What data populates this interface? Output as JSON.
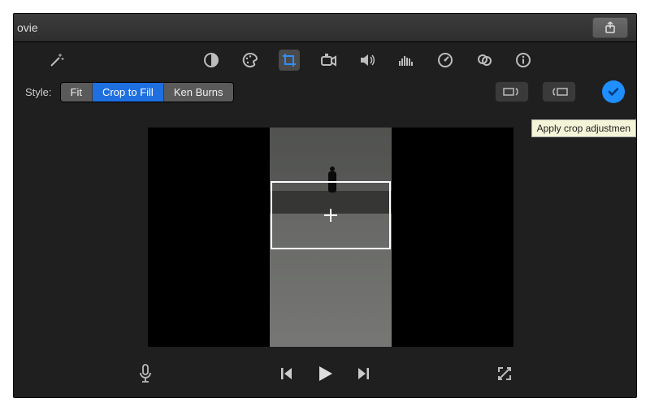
{
  "titlebar": {
    "title": "ovie"
  },
  "toolbar": {
    "icons": [
      "magic-wand-icon",
      "balance-icon",
      "color-palette-icon",
      "crop-icon",
      "camera-icon",
      "volume-icon",
      "equalizer-icon",
      "speed-gauge-icon",
      "filter-overlap-icon",
      "info-icon"
    ],
    "active": "crop-icon"
  },
  "style": {
    "label": "Style:",
    "options": [
      "Fit",
      "Crop to Fill",
      "Ken Burns"
    ],
    "selected": "Crop to Fill",
    "rotate_ccw": "rotate-ccw",
    "rotate_cw": "rotate-cw",
    "apply_label": "Apply"
  },
  "tooltip": {
    "text": "Apply crop adjustmen"
  },
  "transport": {
    "mic": "microphone",
    "prev": "previous-frame",
    "play": "play",
    "next": "next-frame",
    "fullscreen": "fullscreen"
  }
}
